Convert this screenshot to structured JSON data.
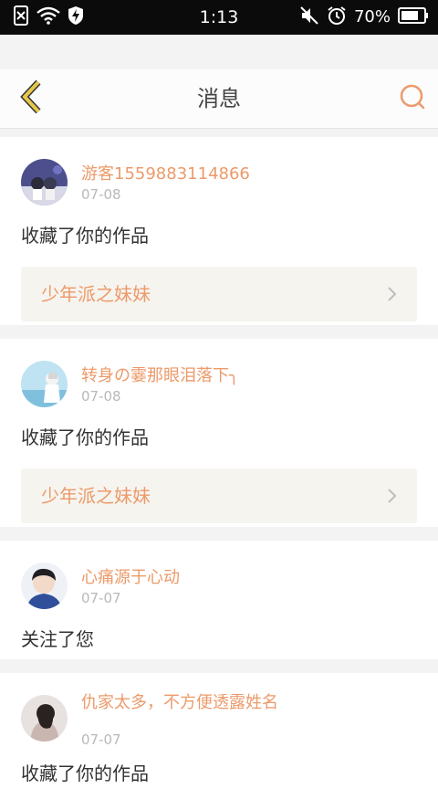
{
  "status_bar": {
    "time": "1:13",
    "battery": "70%",
    "left_icons": [
      "sim-off-icon",
      "wifi-icon",
      "shield-bolt-icon"
    ],
    "right_icons": [
      "mute-icon",
      "alarm-icon",
      "battery-icon"
    ]
  },
  "header": {
    "title": "消息",
    "back_icon": "chevron-left-icon",
    "search_icon": "search-icon"
  },
  "messages": [
    {
      "user": "游客1559883114866",
      "date": "07-08",
      "action": "收藏了你的作品",
      "work": "少年派之妹妹"
    },
    {
      "user": "转身の霎那眼泪落下╮",
      "date": "07-08",
      "action": "收藏了你的作品",
      "work": "少年派之妹妹"
    },
    {
      "user": "心痛源于心动",
      "date": "07-07",
      "action": "关注了您"
    },
    {
      "user": "仇家太多，不方便透露姓名",
      "date": "07-07",
      "action": "收藏了你的作品"
    }
  ],
  "colors": {
    "accent": "#ec9a6a",
    "back_chevron": "#e6c84a",
    "work_bg": "#f6f4ef",
    "date": "#b9b9b9"
  }
}
